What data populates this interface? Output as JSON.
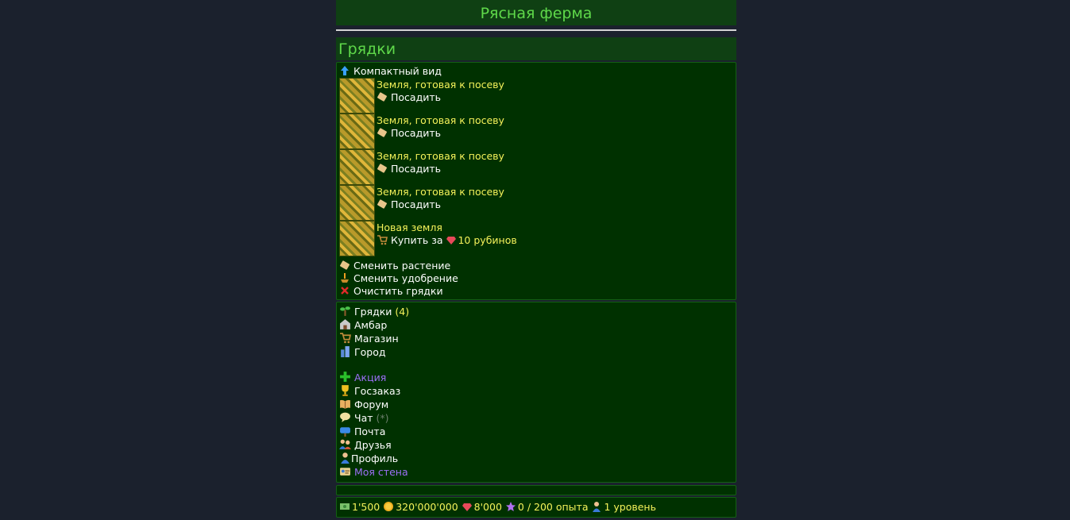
{
  "header": {
    "title": "Рясная ферма"
  },
  "section": {
    "title": "Грядки"
  },
  "compact_view": "Компактный вид",
  "plots": [
    {
      "name": "Земля, готовая к посеву",
      "action": "Посадить"
    },
    {
      "name": "Земля, готовая к посеву",
      "action": "Посадить"
    },
    {
      "name": "Земля, готовая к посеву",
      "action": "Посадить"
    },
    {
      "name": "Земля, готовая к посеву",
      "action": "Посадить"
    }
  ],
  "new_land": {
    "name": "Новая земля",
    "buy_prefix": "Купить за",
    "price": "10 рубинов"
  },
  "bulk_actions": {
    "change_plant": "Сменить растение",
    "change_fertilizer": "Сменить удобрение",
    "clear_beds": "Очистить грядки"
  },
  "nav": {
    "beds": "Грядки",
    "beds_count": "(4)",
    "barn": "Амбар",
    "shop": "Магазин",
    "city": "Город",
    "promo": "Акция",
    "gov_order": "Госзаказ",
    "forum": "Форум",
    "chat": "Чат",
    "chat_badge": "(*)",
    "mail": "Почта",
    "friends": "Друзья",
    "profile": "Профиль",
    "wall": "Моя стена"
  },
  "stats": {
    "cash": "1'500",
    "coins": "320'000'000",
    "rubies": "8'000",
    "experience": "0 / 200 опыта",
    "level": "1 уровень"
  },
  "colors": {
    "background": "#1b212d",
    "panel": "#003100",
    "header": "#0f4013",
    "accent": "#5fd94a",
    "highlight": "#f5f25a",
    "link_special": "#9d6ff7"
  }
}
